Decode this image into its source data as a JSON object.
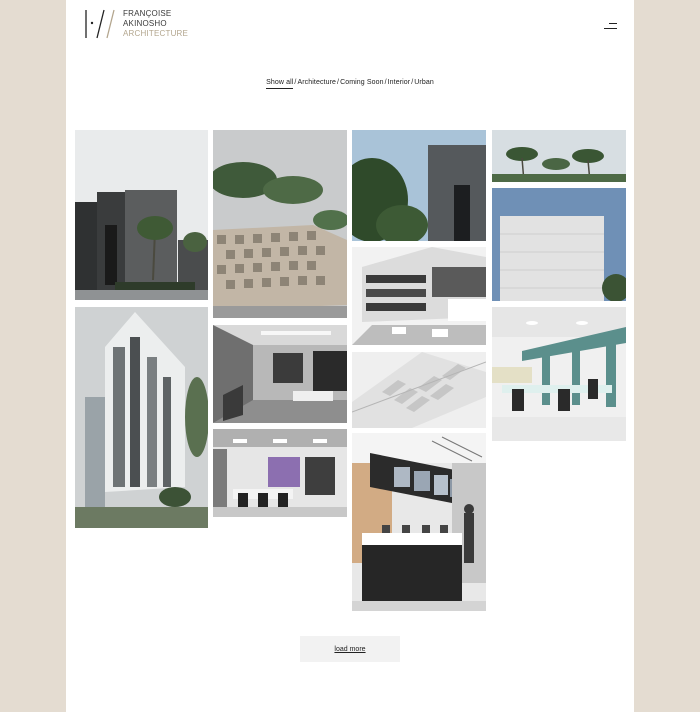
{
  "brand": {
    "name_line1": "FRANÇOISE",
    "name_line2": "AKINOSHO",
    "name_line3": "ARCHITECTURE"
  },
  "header": {
    "menu_icon": "hamburger-menu-icon"
  },
  "filters": {
    "items": [
      "Show all",
      "Architecture",
      "Coming Soon",
      "Interior",
      "Urban"
    ],
    "active": "Show all",
    "separator": "/"
  },
  "gallery": {
    "tiles": [
      {
        "subject": "modern dark villa with palm tree"
      },
      {
        "subject": "residential tower under cloudy sky"
      },
      {
        "subject": "checkered brick screen wall with palms"
      },
      {
        "subject": "grey interior with staircase and lounge"
      },
      {
        "subject": "office interior with purple accent wall"
      },
      {
        "subject": "dark facade with tree"
      },
      {
        "subject": "terraced apartment block with cars"
      },
      {
        "subject": "white site model aerial view"
      },
      {
        "subject": "reception desk with suspended screens"
      },
      {
        "subject": "palm trees against sky"
      },
      {
        "subject": "white louvered building facade"
      },
      {
        "subject": "open plan office with teal columns"
      }
    ]
  },
  "load_more": {
    "label": "load more"
  },
  "colors": {
    "page_background": "#e4dcd1",
    "content_background": "#ffffff",
    "accent": "#b3a68e",
    "text": "#222222"
  }
}
